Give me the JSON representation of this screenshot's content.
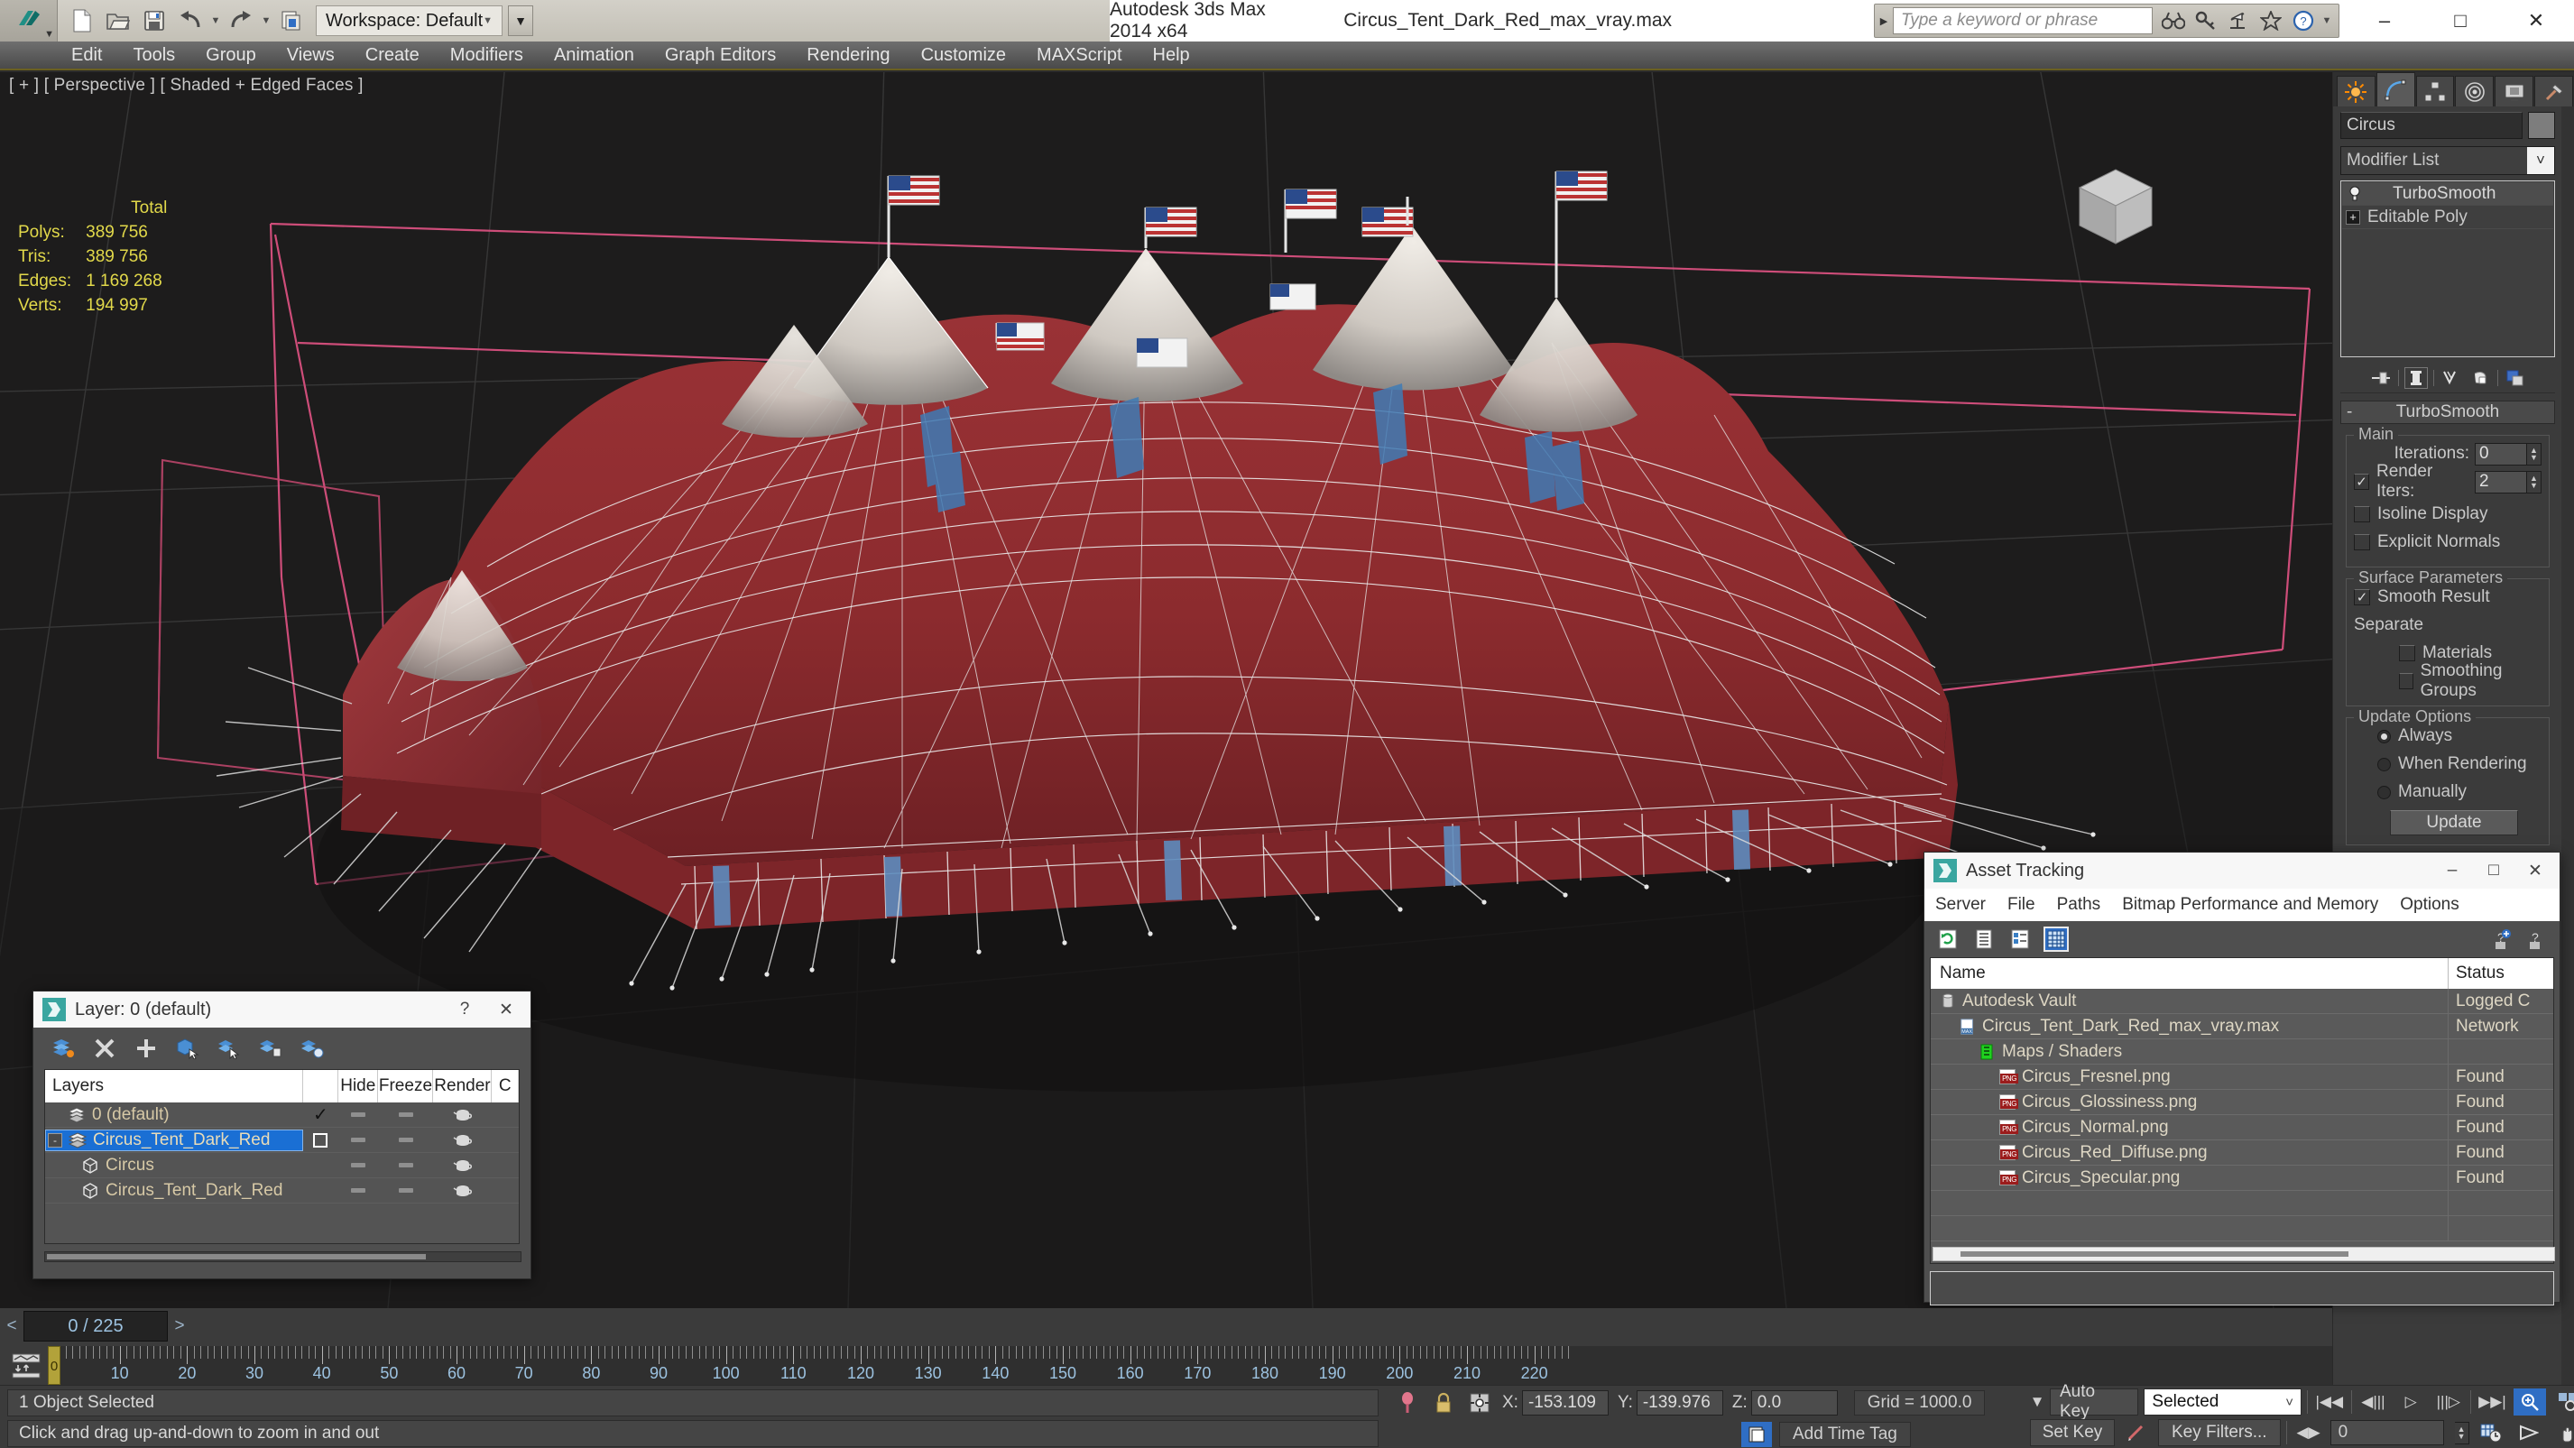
{
  "app": {
    "title": "Autodesk 3ds Max  2014 x64",
    "document": "Circus_Tent_Dark_Red_max_vray.max",
    "workspace_label": "Workspace: Default"
  },
  "quick_access": [
    {
      "name": "new-file-icon",
      "label": "New"
    },
    {
      "name": "open-file-icon",
      "label": "Open"
    },
    {
      "name": "save-file-icon",
      "label": "Save"
    },
    {
      "name": "undo-icon",
      "label": "Undo"
    },
    {
      "name": "redo-icon",
      "label": "Redo"
    },
    {
      "name": "project-folder-icon",
      "label": "Set Project Folder"
    }
  ],
  "search": {
    "placeholder": "Type a keyword or phrase"
  },
  "help_icons": [
    {
      "name": "binoculars-icon",
      "label": "Search"
    },
    {
      "name": "key-icon",
      "label": "Keyboard Shortcut"
    },
    {
      "name": "satellite-dish-icon",
      "label": "Communication Center"
    },
    {
      "name": "star-icon",
      "label": "Favorites"
    },
    {
      "name": "help-icon",
      "label": "Help"
    }
  ],
  "window_buttons": {
    "minimize": "–",
    "maximize": "□",
    "close": "✕"
  },
  "menu": {
    "items": [
      "Edit",
      "Tools",
      "Group",
      "Views",
      "Create",
      "Modifiers",
      "Animation",
      "Graph Editors",
      "Rendering",
      "Customize",
      "MAXScript",
      "Help"
    ]
  },
  "viewport": {
    "label": "[ + ] [ Perspective ] [ Shaded + Edged Faces ]",
    "stats_header": "Total",
    "stats": [
      {
        "label": "Polys:",
        "value": "389 756"
      },
      {
        "label": "Tris:",
        "value": "389 756"
      },
      {
        "label": "Edges:",
        "value": "1 169 268"
      },
      {
        "label": "Verts:",
        "value": "194 997"
      }
    ]
  },
  "command_panel": {
    "tabs": [
      {
        "name": "create-tab",
        "label": "Create"
      },
      {
        "name": "modify-tab",
        "label": "Modify"
      },
      {
        "name": "hierarchy-tab",
        "label": "Hierarchy"
      },
      {
        "name": "motion-tab",
        "label": "Motion"
      },
      {
        "name": "display-tab",
        "label": "Display"
      },
      {
        "name": "utilities-tab",
        "label": "Utilities"
      }
    ],
    "active_tab_index": 1,
    "object_name": "Circus",
    "object_color": "#7d7d7d",
    "modifier_list_label": "Modifier List",
    "stack": [
      {
        "label": "TurboSmooth",
        "selected": true
      },
      {
        "label": "Editable Poly",
        "selected": false
      }
    ],
    "rollout": {
      "title": "TurboSmooth",
      "collapse_glyph": "-",
      "main": {
        "group_title": "Main",
        "iterations_label": "Iterations:",
        "iterations_value": "0",
        "render_iters_label": "Render Iters:",
        "render_iters_value": "2",
        "render_iters_checked": true,
        "isoline_display_label": "Isoline Display",
        "isoline_display_checked": false,
        "explicit_normals_label": "Explicit Normals",
        "explicit_normals_checked": false
      },
      "surface": {
        "group_title": "Surface Parameters",
        "smooth_result_label": "Smooth Result",
        "smooth_result_checked": true,
        "separate_label": "Separate",
        "materials_label": "Materials",
        "materials_checked": false,
        "smoothing_groups_label": "Smoothing Groups",
        "smoothing_groups_checked": false
      },
      "update": {
        "group_title": "Update Options",
        "options": [
          "Always",
          "When Rendering",
          "Manually"
        ],
        "selected_index": 0,
        "update_button": "Update"
      }
    }
  },
  "layer_dialog": {
    "title": "Layer: 0 (default)",
    "help_glyph": "?",
    "close_glyph": "✕",
    "toolbar": [
      {
        "name": "create-new-layer-icon"
      },
      {
        "name": "delete-layer-icon"
      },
      {
        "name": "add-selection-to-layer-icon"
      },
      {
        "name": "select-objects-in-layer-icon"
      },
      {
        "name": "select-highlighted-layers-icon"
      },
      {
        "name": "highlight-selected-objects-layer-icon"
      },
      {
        "name": "layer-properties-icon"
      }
    ],
    "columns": [
      "Layers",
      "",
      "Hide",
      "Freeze",
      "Render",
      "C"
    ],
    "rows": [
      {
        "name": "0 (default)",
        "indent": 0,
        "type": "layer",
        "active": true,
        "selected": false,
        "expander": "",
        "hide": "--",
        "freeze": "--",
        "render": "teapot"
      },
      {
        "name": "Circus_Tent_Dark_Red",
        "indent": 0,
        "type": "layer",
        "active": false,
        "selected": true,
        "expander": "-",
        "hide": "--",
        "freeze": "--",
        "render": "teapot"
      },
      {
        "name": "Circus",
        "indent": 1,
        "type": "object",
        "active": false,
        "selected": false,
        "expander": "",
        "hide": "--",
        "freeze": "--",
        "render": "teapot"
      },
      {
        "name": "Circus_Tent_Dark_Red",
        "indent": 1,
        "type": "object",
        "active": false,
        "selected": false,
        "expander": "",
        "hide": "--",
        "freeze": "--",
        "render": "teapot"
      }
    ]
  },
  "asset_dialog": {
    "title": "Asset Tracking",
    "window_buttons": {
      "minimize": "–",
      "maximize": "□",
      "close": "✕"
    },
    "menu": [
      "Server",
      "File",
      "Paths",
      "Bitmap Performance and Memory",
      "Options"
    ],
    "toolbar": [
      {
        "name": "refresh-icon",
        "active": false
      },
      {
        "name": "list-view-icon",
        "active": false
      },
      {
        "name": "detail-view-icon",
        "active": false
      },
      {
        "name": "grid-view-icon",
        "active": true
      }
    ],
    "toolbar_right": [
      {
        "name": "help-add-icon"
      },
      {
        "name": "help-icon"
      }
    ],
    "columns": [
      "Name",
      "Status"
    ],
    "rows": [
      {
        "name": "Autodesk Vault",
        "status": "Logged C",
        "indent": 0,
        "icon": "vault-icon"
      },
      {
        "name": "Circus_Tent_Dark_Red_max_vray.max",
        "status": "Network",
        "indent": 1,
        "icon": "max-file-icon"
      },
      {
        "name": "Maps / Shaders",
        "status": "",
        "indent": 2,
        "icon": "maps-shaders-icon"
      },
      {
        "name": "Circus_Fresnel.png",
        "status": "Found",
        "indent": 3,
        "icon": "png-icon"
      },
      {
        "name": "Circus_Glossiness.png",
        "status": "Found",
        "indent": 3,
        "icon": "png-icon"
      },
      {
        "name": "Circus_Normal.png",
        "status": "Found",
        "indent": 3,
        "icon": "png-icon"
      },
      {
        "name": "Circus_Red_Diffuse.png",
        "status": "Found",
        "indent": 3,
        "icon": "png-icon"
      },
      {
        "name": "Circus_Specular.png",
        "status": "Found",
        "indent": 3,
        "icon": "png-icon"
      },
      {
        "name": "",
        "status": "",
        "indent": 0,
        "icon": ""
      },
      {
        "name": "",
        "status": "",
        "indent": 0,
        "icon": ""
      }
    ]
  },
  "timeline": {
    "current_frame_label": "0 / 225",
    "prev_glyph": "<",
    "next_glyph": ">",
    "range_start": 0,
    "range_end": 225,
    "playhead_frame": 0,
    "tick_labels": [
      10,
      20,
      30,
      40,
      50,
      60,
      70,
      80,
      90,
      100,
      110,
      120,
      130,
      140,
      150,
      160,
      170,
      180,
      190,
      200,
      210,
      220
    ]
  },
  "status_bar": {
    "selection_text": "1 Object Selected",
    "prompt_text": "Click and drag up-and-down to zoom in and out",
    "coords": [
      {
        "axis": "X:",
        "value": "-153.109"
      },
      {
        "axis": "Y:",
        "value": "-139.976"
      },
      {
        "axis": "Z:",
        "value": "0.0"
      }
    ],
    "grid_text": "Grid = 1000.0",
    "add_time_tag": "Add Time Tag",
    "auto_key_label": "Auto Key",
    "set_key_label": "Set Key",
    "key_mode_value": "Selected",
    "key_filters_label": "Key Filters...",
    "frame_field_value": "0",
    "playback_buttons": [
      {
        "name": "go-to-start-button",
        "glyph": "|◀◀"
      },
      {
        "name": "previous-frame-button",
        "glyph": "◀|||"
      },
      {
        "name": "play-animation-button",
        "glyph": "▷"
      },
      {
        "name": "next-frame-button",
        "glyph": "|||▷"
      },
      {
        "name": "go-to-end-button",
        "glyph": "▶▶|"
      }
    ],
    "view_buttons": [
      {
        "name": "zoom-button",
        "active": false
      },
      {
        "name": "zoom-all-button",
        "active": false
      },
      {
        "name": "zoom-extents-button",
        "active": false
      },
      {
        "name": "zoom-extents-all-button",
        "active": false
      },
      {
        "name": "field-of-view-button",
        "active": false
      },
      {
        "name": "pan-view-button",
        "active": false
      },
      {
        "name": "orbit-button",
        "active": false
      },
      {
        "name": "maximize-viewport-toggle",
        "active": false
      }
    ]
  },
  "colors": {
    "accent_gold": "#b2a23a",
    "accent_blue": "#2f6ec4",
    "tent_red": "#8d2b2e",
    "panel_bg": "#3b3b3b",
    "viewport_bg": "#1d1c1c",
    "stats_yellow": "#e2d94a"
  }
}
